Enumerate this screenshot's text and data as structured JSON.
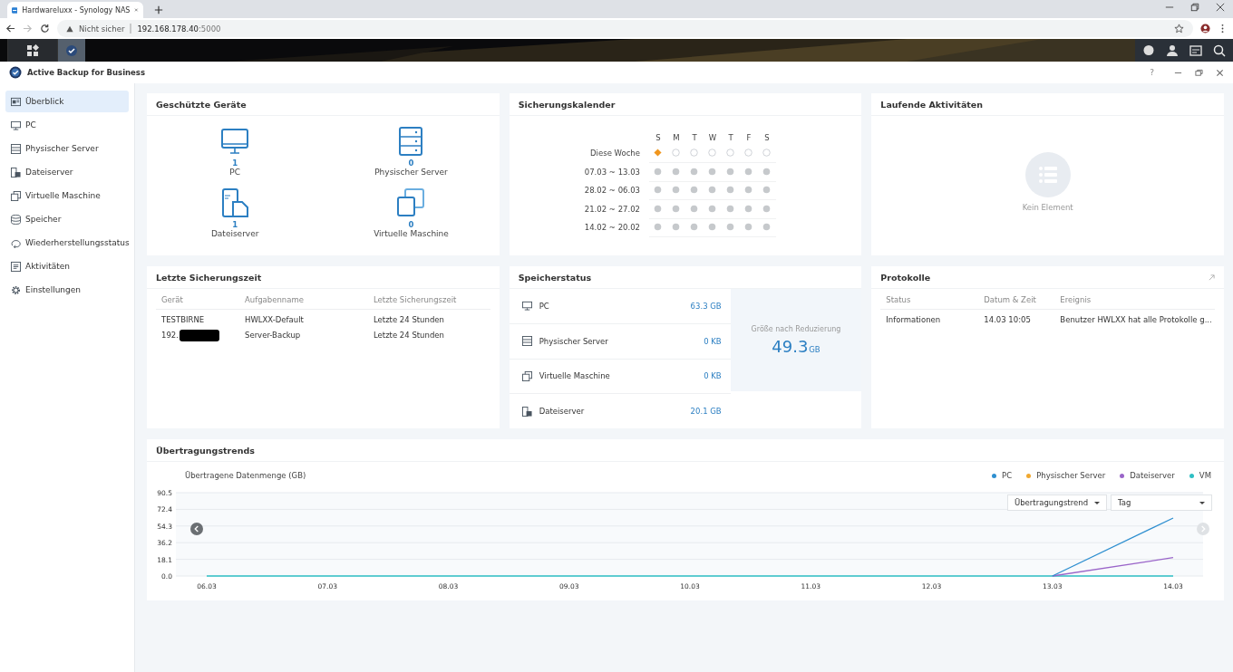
{
  "browser": {
    "tab_title": "Hardwareluxx - Synology NAS",
    "security": "Nicht sicher",
    "url_host": "192.168.178.40",
    "url_port": ":5000"
  },
  "app": {
    "title": "Active Backup for Business",
    "help": "?"
  },
  "sidebar": {
    "items": [
      {
        "label": "Überblick",
        "kind": "overview",
        "selected": true
      },
      {
        "label": "PC",
        "kind": "pc",
        "selected": false
      },
      {
        "label": "Physischer Server",
        "kind": "server",
        "selected": false
      },
      {
        "label": "Dateiserver",
        "kind": "fileserver",
        "selected": false
      },
      {
        "label": "Virtuelle Maschine",
        "kind": "vm",
        "selected": false
      },
      {
        "label": "Speicher",
        "kind": "storage",
        "selected": false
      },
      {
        "label": "Wiederherstellungsstatus",
        "kind": "restore",
        "selected": false
      },
      {
        "label": "Aktivitäten",
        "kind": "activity",
        "selected": false
      },
      {
        "label": "Einstellungen",
        "kind": "settings",
        "selected": false
      }
    ]
  },
  "protected_devices": {
    "title": "Geschützte Geräte",
    "items": [
      {
        "kind": "pc",
        "count": "1",
        "label": "PC"
      },
      {
        "kind": "server",
        "count": "0",
        "label": "Physischer Server"
      },
      {
        "kind": "fileserver",
        "count": "1",
        "label": "Dateiserver"
      },
      {
        "kind": "vm",
        "count": "0",
        "label": "Virtuelle Maschine"
      }
    ]
  },
  "backup_calendar": {
    "title": "Sicherungskalender",
    "days": [
      "S",
      "M",
      "T",
      "W",
      "T",
      "F",
      "S"
    ],
    "weeks": [
      {
        "label": "Diese Woche",
        "cells": [
          {
            "kind": "success"
          },
          {
            "kind": "future"
          },
          {
            "kind": "future"
          },
          {
            "kind": "future"
          },
          {
            "kind": "future"
          },
          {
            "kind": "future"
          },
          {
            "kind": "future"
          }
        ]
      },
      {
        "label": "07.03 ~ 13.03",
        "cells": [
          {
            "kind": "none"
          },
          {
            "kind": "none"
          },
          {
            "kind": "none"
          },
          {
            "kind": "none"
          },
          {
            "kind": "none"
          },
          {
            "kind": "none"
          },
          {
            "kind": "none"
          }
        ]
      },
      {
        "label": "28.02 ~ 06.03",
        "cells": [
          {
            "kind": "none"
          },
          {
            "kind": "none"
          },
          {
            "kind": "none"
          },
          {
            "kind": "none"
          },
          {
            "kind": "none"
          },
          {
            "kind": "none"
          },
          {
            "kind": "none"
          }
        ]
      },
      {
        "label": "21.02 ~ 27.02",
        "cells": [
          {
            "kind": "none"
          },
          {
            "kind": "none"
          },
          {
            "kind": "none"
          },
          {
            "kind": "none"
          },
          {
            "kind": "none"
          },
          {
            "kind": "none"
          },
          {
            "kind": "none"
          }
        ]
      },
      {
        "label": "14.02 ~ 20.02",
        "cells": [
          {
            "kind": "none"
          },
          {
            "kind": "none"
          },
          {
            "kind": "none"
          },
          {
            "kind": "none"
          },
          {
            "kind": "none"
          },
          {
            "kind": "none"
          },
          {
            "kind": "none"
          }
        ]
      }
    ]
  },
  "running_activities": {
    "title": "Laufende Aktivitäten",
    "empty_text": "Kein Element"
  },
  "last_backup": {
    "title": "Letzte Sicherungszeit",
    "columns": [
      "Gerät",
      "Aufgabenname",
      "Letzte Sicherungszeit"
    ],
    "rows": [
      {
        "device": "TESTBIRNE",
        "redacted": false,
        "task": "HWLXX-Default",
        "time": "Letzte 24 Stunden"
      },
      {
        "device": "192.",
        "redacted": true,
        "task": "Server-Backup",
        "time": "Letzte 24 Stunden"
      }
    ]
  },
  "storage_status": {
    "title": "Speicherstatus",
    "items": [
      {
        "kind": "pc",
        "label": "PC",
        "value": "63.3 GB"
      },
      {
        "kind": "server",
        "label": "Physischer Server",
        "value": "0 KB"
      },
      {
        "kind": "vm",
        "label": "Virtuelle Maschine",
        "value": "0 KB"
      },
      {
        "kind": "fileserver",
        "label": "Dateiserver",
        "value": "20.1 GB"
      }
    ],
    "summary_label": "Größe nach Reduzierung",
    "summary_value": "49.3",
    "summary_unit": "GB"
  },
  "logs": {
    "title": "Protokolle",
    "columns": [
      "Status",
      "Datum & Zeit",
      "Ereignis"
    ],
    "rows": [
      {
        "status": "Informationen",
        "datetime": "14.03 10:05",
        "event": "Benutzer HWLXX hat alle Protokolle g..."
      }
    ]
  },
  "transfer_trends": {
    "title": "Übertragungstrends",
    "trend_select": "Übertragungstrend",
    "period_select": "Tag",
    "chart_data": {
      "type": "line",
      "ylabel": "Übertragene Datenmenge (GB)",
      "categories": [
        "06.03",
        "07.03",
        "08.03",
        "09.03",
        "10.03",
        "11.03",
        "12.03",
        "13.03",
        "14.03"
      ],
      "ylim": [
        0,
        90.5
      ],
      "yticks": [
        {
          "value": 0,
          "label": "0.0"
        },
        18.1,
        36.2,
        54.3,
        72.4,
        90.5
      ],
      "grid": true,
      "series": [
        {
          "name": "PC",
          "color": "#2e8fd0",
          "values": [
            null,
            null,
            null,
            null,
            null,
            null,
            null,
            0,
            63
          ]
        },
        {
          "name": "Physischer Server",
          "color": "#f0a830",
          "values": [
            null,
            null,
            null,
            null,
            null,
            null,
            null,
            null,
            null
          ]
        },
        {
          "name": "Dateiserver",
          "color": "#9a65c9",
          "values": [
            null,
            null,
            null,
            null,
            null,
            null,
            null,
            0,
            20
          ]
        },
        {
          "name": "VM",
          "color": "#2ebfc4",
          "values": [
            0,
            0,
            0,
            0,
            0,
            0,
            0,
            0,
            0
          ]
        }
      ]
    }
  }
}
